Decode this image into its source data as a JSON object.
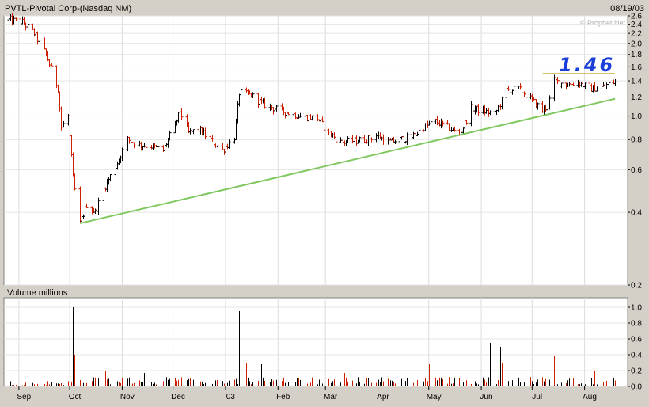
{
  "header": {
    "title": "PVTL-Pivotal Corp-(Nasdaq NM)",
    "date": "08/19/03",
    "watermark": "© Prophet.Net"
  },
  "chart_data": [
    {
      "type": "ohlc",
      "title": "PVTL-Pivotal Corp-(Nasdaq NM)",
      "y_scale": "log",
      "ylim": [
        0.2,
        2.6
      ],
      "y_ticks": [
        2.6,
        2.4,
        2.2,
        2.0,
        1.8,
        1.6,
        1.4,
        1.2,
        1.0,
        0.8,
        0.6,
        0.4,
        0.2
      ],
      "x_ticks": [
        "Sep",
        "Oct",
        "Nov",
        "Dec",
        "03",
        "Feb",
        "Mar",
        "Apr",
        "May",
        "Jun",
        "Jul",
        "Aug"
      ],
      "price_path": [
        [
          "2002-08-26",
          2.5
        ],
        [
          "2002-09-03",
          2.45
        ],
        [
          "2002-09-10",
          2.2
        ],
        [
          "2002-09-17",
          1.8
        ],
        [
          "2002-09-24",
          1.3
        ],
        [
          "2002-09-26",
          0.9
        ],
        [
          "2002-09-30",
          1.0
        ],
        [
          "2002-10-03",
          0.55
        ],
        [
          "2002-10-07",
          0.36
        ],
        [
          "2002-10-11",
          0.43
        ],
        [
          "2002-10-16",
          0.4
        ],
        [
          "2002-10-21",
          0.5
        ],
        [
          "2002-10-28",
          0.62
        ],
        [
          "2002-11-04",
          0.8
        ],
        [
          "2002-11-11",
          0.76
        ],
        [
          "2002-11-18",
          0.75
        ],
        [
          "2002-11-25",
          0.72
        ],
        [
          "2002-12-02",
          0.92
        ],
        [
          "2002-12-05",
          1.05
        ],
        [
          "2002-12-10",
          0.85
        ],
        [
          "2002-12-16",
          0.88
        ],
        [
          "2002-12-23",
          0.8
        ],
        [
          "2002-12-30",
          0.72
        ],
        [
          "2003-01-06",
          0.82
        ],
        [
          "2003-01-09",
          1.25
        ],
        [
          "2003-01-16",
          1.22
        ],
        [
          "2003-01-23",
          1.12
        ],
        [
          "2003-02-03",
          1.05
        ],
        [
          "2003-02-14",
          1.0
        ],
        [
          "2003-02-24",
          0.98
        ],
        [
          "2003-03-03",
          0.85
        ],
        [
          "2003-03-10",
          0.78
        ],
        [
          "2003-03-24",
          0.8
        ],
        [
          "2003-03-31",
          0.83
        ],
        [
          "2003-04-07",
          0.78
        ],
        [
          "2003-04-14",
          0.8
        ],
        [
          "2003-04-21",
          0.82
        ],
        [
          "2003-04-28",
          0.9
        ],
        [
          "2003-05-05",
          0.95
        ],
        [
          "2003-05-12",
          0.9
        ],
        [
          "2003-05-19",
          0.84
        ],
        [
          "2003-05-26",
          1.08
        ],
        [
          "2003-06-02",
          1.05
        ],
        [
          "2003-06-09",
          1.02
        ],
        [
          "2003-06-16",
          1.28
        ],
        [
          "2003-06-23",
          1.3
        ],
        [
          "2003-06-30",
          1.18
        ],
        [
          "2003-07-07",
          1.05
        ],
        [
          "2003-07-10",
          1.1
        ],
        [
          "2003-07-14",
          1.4
        ],
        [
          "2003-07-21",
          1.35
        ],
        [
          "2003-07-28",
          1.38
        ],
        [
          "2003-08-04",
          1.3
        ],
        [
          "2003-08-11",
          1.32
        ],
        [
          "2003-08-18",
          1.38
        ]
      ],
      "trendline": {
        "start": [
          "2002-10-07",
          0.36
        ],
        "end": [
          "2003-08-19",
          1.18
        ],
        "color": "#80c860"
      },
      "resistance_line": {
        "start": [
          "2003-07-10",
          1.5
        ],
        "end": [
          "2003-08-19",
          1.5
        ],
        "color": "#c8a020"
      },
      "annotation": {
        "text": "1.46",
        "color": "#1a3fd8"
      },
      "bar_colors": {
        "up": "#000000",
        "down": "#cc2000"
      }
    },
    {
      "type": "bar",
      "title": "Volume  millions",
      "ylim": [
        0,
        1.0
      ],
      "y_ticks": [
        1.0,
        0.8,
        0.6,
        0.4,
        0.2,
        0.0
      ],
      "baseline_level": 0.08,
      "spikes": [
        [
          "2002-10-03",
          1.0
        ],
        [
          "2002-10-04",
          0.4
        ],
        [
          "2002-10-08",
          0.25
        ],
        [
          "2002-10-22",
          0.2
        ],
        [
          "2002-11-14",
          0.17
        ],
        [
          "2003-01-09",
          0.95
        ],
        [
          "2003-01-10",
          0.7
        ],
        [
          "2003-01-13",
          0.3
        ],
        [
          "2003-01-22",
          0.28
        ],
        [
          "2003-03-12",
          0.17
        ],
        [
          "2003-05-01",
          0.28
        ],
        [
          "2003-06-06",
          0.55
        ],
        [
          "2003-06-12",
          0.5
        ],
        [
          "2003-06-13",
          0.3
        ],
        [
          "2003-07-10",
          0.86
        ],
        [
          "2003-07-14",
          0.38
        ],
        [
          "2003-07-24",
          0.25
        ],
        [
          "2003-08-07",
          0.2
        ]
      ]
    }
  ]
}
